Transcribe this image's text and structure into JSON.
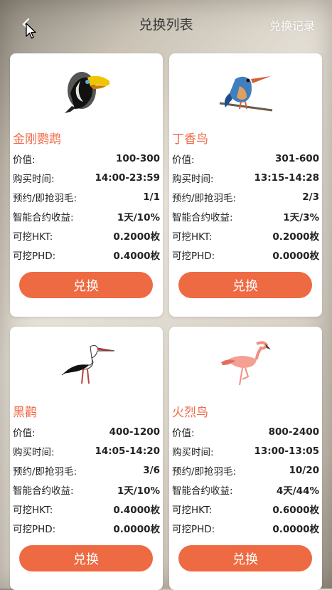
{
  "header": {
    "title": "兑换列表",
    "record_label": "兑换记录"
  },
  "labels": {
    "value": "价值:",
    "time": "购买时间:",
    "reserve": "预约/即抢羽毛:",
    "contract": "智能合约收益:",
    "hkt": "可挖HKT:",
    "phd": "可挖PHD:"
  },
  "cards": [
    {
      "name": "金刚鹦鹉",
      "icon": "toucan-icon",
      "value": "100-300",
      "time": "14:00-23:59",
      "reserve": "1/1",
      "contract": "1天/10%",
      "hkt": "0.2000枚",
      "phd": "0.4000枚",
      "button": "兑换"
    },
    {
      "name": "丁香鸟",
      "icon": "kingfisher-icon",
      "value": "301-600",
      "time": "13:15-14:28",
      "reserve": "2/3",
      "contract": "1天/3%",
      "hkt": "0.2000枚",
      "phd": "0.0000枚",
      "button": "兑换"
    },
    {
      "name": "黑鹳",
      "icon": "stork-icon",
      "value": "400-1200",
      "time": "14:05-14:20",
      "reserve": "3/6",
      "contract": "1天/10%",
      "hkt": "0.4000枚",
      "phd": "0.0000枚",
      "button": "兑换"
    },
    {
      "name": "火烈鸟",
      "icon": "flamingo-icon",
      "value": "800-2400",
      "time": "13:00-13:05",
      "reserve": "10/20",
      "contract": "4天/44%",
      "hkt": "0.6000枚",
      "phd": "0.0000枚",
      "button": "兑换"
    }
  ],
  "colors": {
    "accent": "#ee6a43",
    "name": "#f06b4a"
  }
}
